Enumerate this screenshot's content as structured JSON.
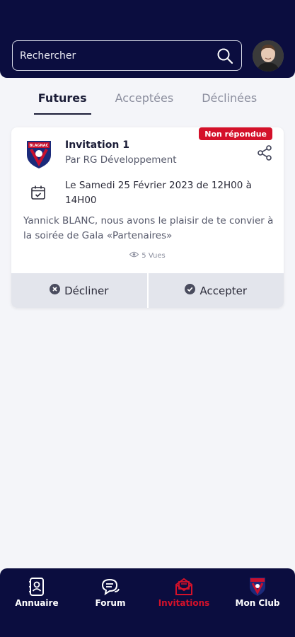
{
  "header": {
    "search": {
      "placeholder": "Rechercher"
    },
    "avatar_icon": "user-avatar"
  },
  "tabs": [
    {
      "label": "Futures",
      "active": true
    },
    {
      "label": "Acceptées",
      "active": false
    },
    {
      "label": "Déclinées",
      "active": false
    }
  ],
  "invitation": {
    "badge": "Non répondue",
    "title": "Invitation 1",
    "organizer": "Par RG Développement",
    "date": "Le Samedi 25 Février 2023 de 12H00 à 14H00",
    "description": "Yannick BLANC, nous avons le plaisir de te convier à la soirée de Gala «Partenaires»",
    "views": "5 Vues",
    "decline_label": "Décliner",
    "accept_label": "Accepter"
  },
  "bottom_nav": [
    {
      "label": "Annuaire",
      "icon": "directory-icon",
      "active": false
    },
    {
      "label": "Forum",
      "icon": "chat-icon",
      "active": false
    },
    {
      "label": "Invitations",
      "icon": "mail-icon",
      "active": true
    },
    {
      "label": "Mon Club",
      "icon": "club-crest-icon",
      "active": false
    }
  ],
  "colors": {
    "navy": "#0b0d3f",
    "accent_red": "#d4112a",
    "background": "#f4f5f9"
  }
}
